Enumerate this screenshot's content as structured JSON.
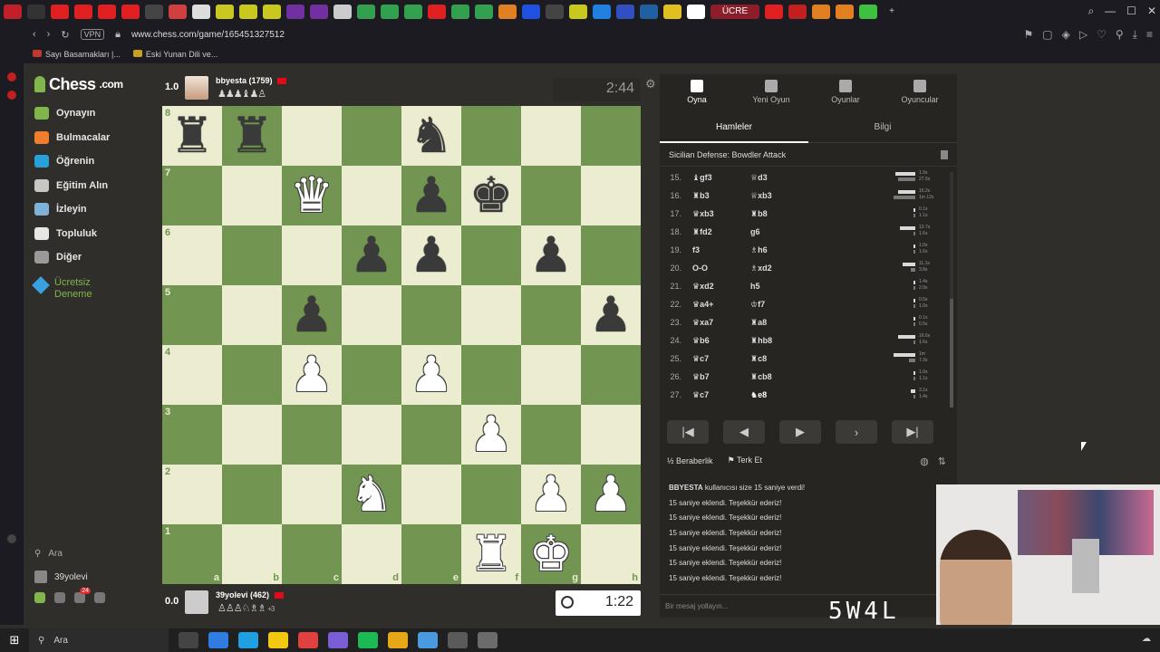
{
  "browser": {
    "active_tab_label": "ÜCRE",
    "url": "www.chess.com/game/165451327512",
    "vpn_label": "VPN",
    "bookmarks": [
      "Sayı Basamakları |...",
      "Eski Yunan Dili ve..."
    ]
  },
  "sidebar": {
    "logo": "Chess",
    "logo_suffix": ".com",
    "items": [
      {
        "label": "Oynayın",
        "color": "#81b64c"
      },
      {
        "label": "Bulmacalar",
        "color": "#f07c2c"
      },
      {
        "label": "Öğrenin",
        "color": "#27a1d8"
      },
      {
        "label": "Eğitim Alın",
        "color": "#c7c7c7"
      },
      {
        "label": "İzleyin",
        "color": "#7fb2d8"
      },
      {
        "label": "Topluluk",
        "color": "#e6e6e6"
      },
      {
        "label": "Diğer",
        "color": "#999999"
      }
    ],
    "premium_label": "Ücretsiz Deneme",
    "search_label": "Ara",
    "username": "39yolevi",
    "notification_count": "24"
  },
  "top_player": {
    "eval": "1.0",
    "name": "bbyesta",
    "rating": "(1759)",
    "captured": "♟♟♟♝♟♙",
    "clock": "2:44"
  },
  "bottom_player": {
    "eval": "0.0",
    "name": "39yolevi",
    "rating": "(462)",
    "captured": "♙♙♙♘♗♗",
    "captured_plus": "+3",
    "clock": "1:22"
  },
  "board": {
    "orientation": "white",
    "ranks": [
      "8",
      "7",
      "6",
      "5",
      "4",
      "3",
      "2",
      "1"
    ],
    "files": [
      "a",
      "b",
      "c",
      "d",
      "e",
      "f",
      "g",
      "h"
    ],
    "light_color": "#ebecd0",
    "dark_color": "#739552",
    "position": [
      [
        "br",
        "br",
        "",
        "",
        "bn",
        "",
        "",
        ""
      ],
      [
        "",
        "",
        "wq",
        "",
        "bp",
        "bk",
        "",
        ""
      ],
      [
        "",
        "",
        "",
        "bp",
        "bp",
        "",
        "bp",
        ""
      ],
      [
        "",
        "",
        "bp",
        "",
        "",
        "",
        "",
        "bp"
      ],
      [
        "",
        "",
        "wp",
        "",
        "wp",
        "",
        "",
        ""
      ],
      [
        "",
        "",
        "",
        "",
        "",
        "wp",
        "",
        ""
      ],
      [
        "",
        "",
        "",
        "wn",
        "",
        "",
        "wp",
        "wp"
      ],
      [
        "",
        "",
        "",
        "",
        "",
        "wr",
        "wk",
        ""
      ]
    ]
  },
  "panel": {
    "tabs": [
      "Oyna",
      "Yeni Oyun",
      "Oyunlar",
      "Oyuncular"
    ],
    "subtabs": [
      "Hamleler",
      "Bilgi"
    ],
    "opening": "Sicilian Defense: Bowdler Attack",
    "moves": [
      {
        "n": "15.",
        "w": "♝gf3",
        "b": "♕d3",
        "wt": [
          "1.9s",
          "27.5s"
        ],
        "bt": [
          0.9,
          0.8
        ]
      },
      {
        "n": "16.",
        "w": "♜b3",
        "b": "♕xb3",
        "wt": [
          "16.2s",
          "1m 12s"
        ],
        "bt": [
          0.8,
          1.0
        ]
      },
      {
        "n": "17.",
        "w": "♛xb3",
        "b": "♜b8",
        "wt": [
          "0.1s",
          "1.1s"
        ],
        "bt": [
          0.1,
          0.1
        ]
      },
      {
        "n": "18.",
        "w": "♜fd2",
        "b": "g6",
        "wt": [
          "13.7s",
          "1.6s"
        ],
        "bt": [
          0.7,
          0.1
        ]
      },
      {
        "n": "19.",
        "w": "f3",
        "b": "♗h6",
        "wt": [
          "1.0s",
          "1.6s"
        ],
        "bt": [
          0.1,
          0.1
        ]
      },
      {
        "n": "20.",
        "w": "O-O",
        "b": "♗xd2",
        "wt": [
          "11.1s",
          "3.8s"
        ],
        "bt": [
          0.6,
          0.2
        ]
      },
      {
        "n": "21.",
        "w": "♛xd2",
        "b": "h5",
        "wt": [
          "1.4s",
          "2.0s"
        ],
        "bt": [
          0.1,
          0.1
        ]
      },
      {
        "n": "22.",
        "w": "♛a4+",
        "b": "♔f7",
        "wt": [
          "0.5s",
          "1.0s"
        ],
        "bt": [
          0.1,
          0.1
        ]
      },
      {
        "n": "23.",
        "w": "♛xa7",
        "b": "♜a8",
        "wt": [
          "0.1s",
          "0.5s"
        ],
        "bt": [
          0.1,
          0.1
        ]
      },
      {
        "n": "24.",
        "w": "♛b6",
        "b": "♜hb8",
        "wt": [
          "16.6s",
          "1.6s"
        ],
        "bt": [
          0.8,
          0.1
        ]
      },
      {
        "n": "25.",
        "w": "♛c7",
        "b": "♜c8",
        "wt": [
          "1m",
          "7.3s"
        ],
        "bt": [
          1.0,
          0.3
        ]
      },
      {
        "n": "26.",
        "w": "♛b7",
        "b": "♜cb8",
        "wt": [
          "1.0s",
          "1.1s"
        ],
        "bt": [
          0.1,
          0.1
        ]
      },
      {
        "n": "27.",
        "w": "♛c7",
        "b": "♞e8",
        "wt": [
          "3.1s",
          "1.4s"
        ],
        "bt": [
          0.2,
          0.1
        ]
      }
    ],
    "draw_label": "Beraberlik",
    "resign_label": "Terk Et",
    "chat": [
      {
        "user": "BBYESTA",
        "text": " kullanıcısı size 15 saniye verdi!"
      },
      {
        "user": "",
        "text": "15 saniye eklendi. Teşekkür ederiz!"
      },
      {
        "user": "",
        "text": "15 saniye eklendi. Teşekkür ederiz!"
      },
      {
        "user": "",
        "text": "15 saniye eklendi. Teşekkür ederiz!"
      },
      {
        "user": "",
        "text": "15 saniye eklendi. Teşekkür ederiz!"
      },
      {
        "user": "",
        "text": "15 saniye eklendi. Teşekkür ederiz!"
      },
      {
        "user": "",
        "text": "15 saniye eklendi. Teşekkür ederiz!"
      }
    ],
    "chat_placeholder": "Bir mesaj yollayın..."
  },
  "overlay": {
    "score": "5W4L"
  },
  "taskbar": {
    "search_label": "Ara",
    "app_colors": [
      "#444",
      "#2f7de1",
      "#1fa0e3",
      "#f2c811",
      "#e04040",
      "#7b5ed6",
      "#1db954",
      "#e6a817",
      "#4a9ae0",
      "#5a5a5a",
      "#6b6b6b"
    ]
  }
}
